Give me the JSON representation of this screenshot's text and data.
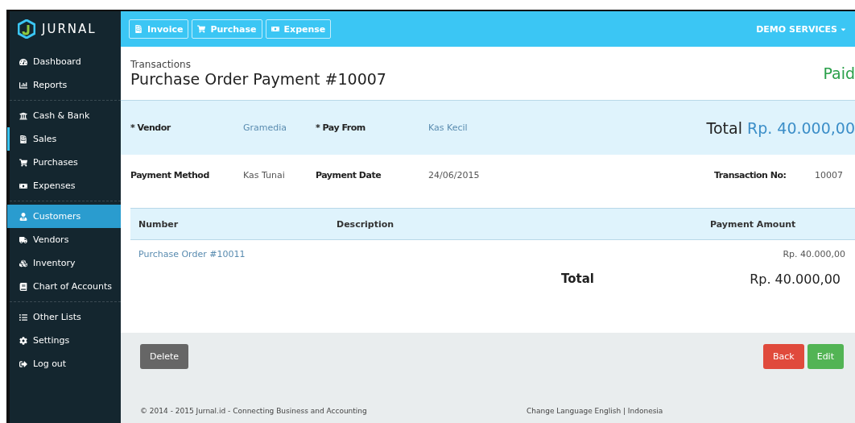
{
  "brand": {
    "name": "JURNAL"
  },
  "toolbar": {
    "buttons": [
      {
        "label": "Invoice"
      },
      {
        "label": "Purchase"
      },
      {
        "label": "Expense"
      }
    ],
    "account": "DEMO SERVICES"
  },
  "sidebar": {
    "groups": [
      {
        "items": [
          {
            "label": "Dashboard",
            "selected": false,
            "current": false
          },
          {
            "label": "Reports",
            "selected": false,
            "current": false
          }
        ]
      },
      {
        "items": [
          {
            "label": "Cash & Bank",
            "selected": false,
            "current": false
          },
          {
            "label": "Sales",
            "selected": false,
            "current": true
          },
          {
            "label": "Purchases",
            "selected": false,
            "current": false
          },
          {
            "label": "Expenses",
            "selected": false,
            "current": false
          }
        ]
      },
      {
        "items": [
          {
            "label": "Customers",
            "selected": true,
            "current": false
          },
          {
            "label": "Vendors",
            "selected": false,
            "current": false
          },
          {
            "label": "Inventory",
            "selected": false,
            "current": false
          },
          {
            "label": "Chart of Accounts",
            "selected": false,
            "current": false
          }
        ]
      },
      {
        "items": [
          {
            "label": "Other Lists",
            "selected": false,
            "current": false
          },
          {
            "label": "Settings",
            "selected": false,
            "current": false
          },
          {
            "label": "Log out",
            "selected": false,
            "current": false
          }
        ]
      }
    ]
  },
  "header": {
    "breadcrumb": "Transactions",
    "title": "Purchase Order Payment #10007",
    "status": "Paid"
  },
  "summary": {
    "vendor_label": "* Vendor",
    "vendor": "Gramedia",
    "pay_from_label": "* Pay From",
    "pay_from": "Kas Kecil",
    "total_label": "Total",
    "total": "Rp. 40.000,00"
  },
  "details": {
    "method_label": "Payment Method",
    "method": "Kas Tunai",
    "date_label": "Payment Date",
    "date": "24/06/2015",
    "txn_label": "Transaction No:",
    "txn": "10007"
  },
  "table": {
    "columns": [
      "Number",
      "Description",
      "Payment Amount"
    ],
    "rows": [
      {
        "number": "Purchase Order #10011",
        "amount": "Rp. 40.000,00"
      }
    ],
    "total_label": "Total",
    "total": "Rp. 40.000,00"
  },
  "actions": {
    "delete": "Delete",
    "back": "Back",
    "edit": "Edit"
  },
  "footer": {
    "copyright": "© 2014 - 2015 Jurnal.id - Connecting Business and Accounting",
    "language": "Change Language English | Indonesia"
  }
}
